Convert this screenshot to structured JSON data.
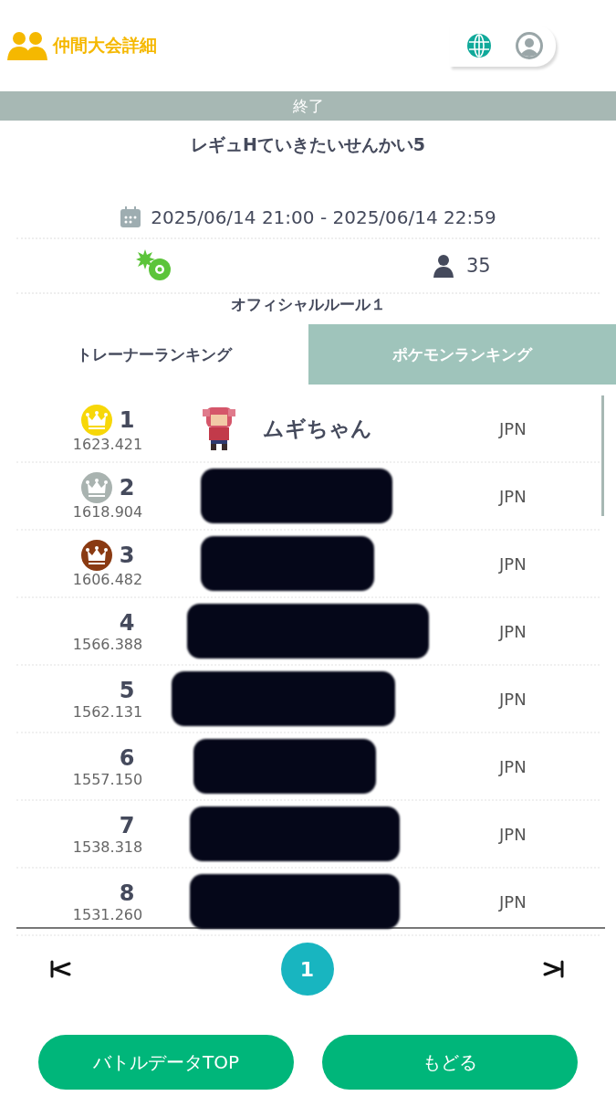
{
  "header": {
    "title": "仲間大会詳細"
  },
  "status": {
    "label": "終了"
  },
  "tournament": {
    "name": "レギュHていきたいせんかい5",
    "period": "2025/06/14 21:00 - 2025/06/14 22:59",
    "participants": "35",
    "rule": "オフィシャルルール１"
  },
  "tabs": [
    {
      "label": "トレーナーランキング",
      "selected": true
    },
    {
      "label": "ポケモンランキング",
      "selected": false
    }
  ],
  "ranking": [
    {
      "rank": "1",
      "score": "1623.421",
      "color": "#f7d708",
      "name": "ムギちゃん",
      "country": "JPN",
      "redacted": false
    },
    {
      "rank": "2",
      "score": "1618.904",
      "color": "#a9b3b0",
      "country": "JPN",
      "redacted": true
    },
    {
      "rank": "3",
      "score": "1606.482",
      "color": "#8a3a12",
      "country": "JPN",
      "redacted": true
    },
    {
      "rank": "4",
      "score": "1566.388",
      "country": "JPN",
      "redacted": true
    },
    {
      "rank": "5",
      "score": "1562.131",
      "country": "JPN",
      "redacted": true
    },
    {
      "rank": "6",
      "score": "1557.150",
      "country": "JPN",
      "redacted": true
    },
    {
      "rank": "7",
      "score": "1538.318",
      "country": "JPN",
      "redacted": true
    },
    {
      "rank": "8",
      "score": "1531.260",
      "country": "JPN",
      "redacted": true
    }
  ],
  "pagination": {
    "pages": [
      {
        "label": "1",
        "selected": true
      }
    ]
  },
  "buttons": [
    "バトルデータTOP",
    "もどる"
  ]
}
